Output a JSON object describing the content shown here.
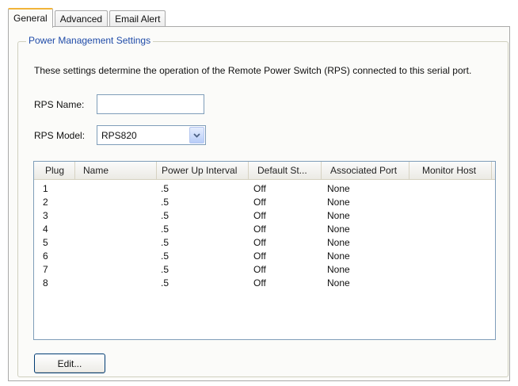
{
  "tabs": [
    {
      "label": "General",
      "active": true
    },
    {
      "label": "Advanced",
      "active": false
    },
    {
      "label": "Email Alert",
      "active": false
    }
  ],
  "group": {
    "title": "Power Management Settings",
    "description": "These settings determine the operation of the Remote Power Switch (RPS) connected to this serial port."
  },
  "form": {
    "name_label": "RPS Name:",
    "name_value": "",
    "model_label": "RPS Model:",
    "model_value": "RPS820"
  },
  "table": {
    "columns": [
      "Plug",
      "Name",
      "Power Up Interval",
      "Default St...",
      "Associated Port",
      "Monitor Host"
    ],
    "rows": [
      [
        "1",
        "",
        ".5",
        "Off",
        "None",
        ""
      ],
      [
        "2",
        "",
        ".5",
        "Off",
        "None",
        ""
      ],
      [
        "3",
        "",
        ".5",
        "Off",
        "None",
        ""
      ],
      [
        "4",
        "",
        ".5",
        "Off",
        "None",
        ""
      ],
      [
        "5",
        "",
        ".5",
        "Off",
        "None",
        ""
      ],
      [
        "6",
        "",
        ".5",
        "Off",
        "None",
        ""
      ],
      [
        "7",
        "",
        ".5",
        "Off",
        "None",
        ""
      ],
      [
        "8",
        "",
        ".5",
        "Off",
        "None",
        ""
      ]
    ]
  },
  "buttons": {
    "edit_label": "Edit..."
  },
  "colors": {
    "accent_tab": "#f2b43a",
    "group_title": "#1f4ba8",
    "input_border": "#7f9db9"
  },
  "icons": {
    "combo_arrow": "chevron-down-icon"
  }
}
